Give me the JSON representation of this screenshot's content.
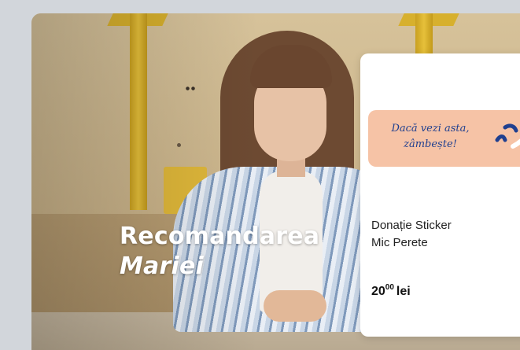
{
  "hero": {
    "title_line1": "Recomandarea",
    "title_line2": "Mariei"
  },
  "product": {
    "sticker_line1": "Dacă vezi asta,",
    "sticker_line2": "zâmbește!",
    "name_line1": "Donație Sticker",
    "name_line2": "Mic Perete",
    "price_int": "20",
    "price_dec": "00",
    "currency": "lei"
  },
  "colors": {
    "sticker_bg": "#f6c3a6",
    "sticker_text": "#1f3f8f",
    "card_bg": "#ffffff"
  }
}
